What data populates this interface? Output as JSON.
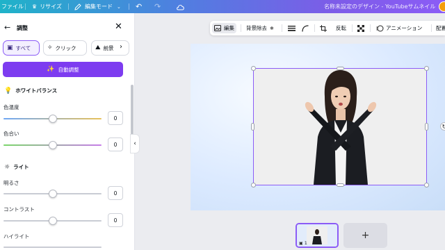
{
  "topbar": {
    "file_label": "ファイル",
    "resize_label": "リサイズ",
    "edit_mode_label": "編集モード",
    "title": "名称未設定のデザイン - YouTubeサムネイル",
    "accent_gradient": [
      "#1fb3c9",
      "#8b5cf6"
    ]
  },
  "panel": {
    "title": "調整",
    "chips": [
      {
        "label": "すべて",
        "icon": "image-icon"
      },
      {
        "label": "クリック",
        "icon": "sparkle-cursor-icon"
      },
      {
        "label": "前景",
        "icon": "foreground-icon"
      }
    ],
    "auto_adjust_label": "自動調整",
    "sections": {
      "white_balance": "ホワイトバランス",
      "light": "ライト"
    },
    "sliders": {
      "temperature": {
        "label": "色温度",
        "value": "0",
        "level": 0.5
      },
      "tint": {
        "label": "色合い",
        "value": "0",
        "level": 0.5
      },
      "brightness": {
        "label": "明るさ",
        "value": "0",
        "level": 0.5
      },
      "contrast": {
        "label": "コントラスト",
        "value": "0",
        "level": 0.5
      },
      "highlights": {
        "label": "ハイライト"
      }
    }
  },
  "context_toolbar": {
    "edit_label": "編集",
    "bg_remove_label": "背景除去",
    "flip_label": "反転",
    "animation_label": "アニメーション",
    "position_label": "配置"
  },
  "pages": {
    "current_page": "1",
    "add_label": "+"
  },
  "colors": {
    "accent": "#8b5cf6",
    "auto_button": "#7d3cf0"
  }
}
